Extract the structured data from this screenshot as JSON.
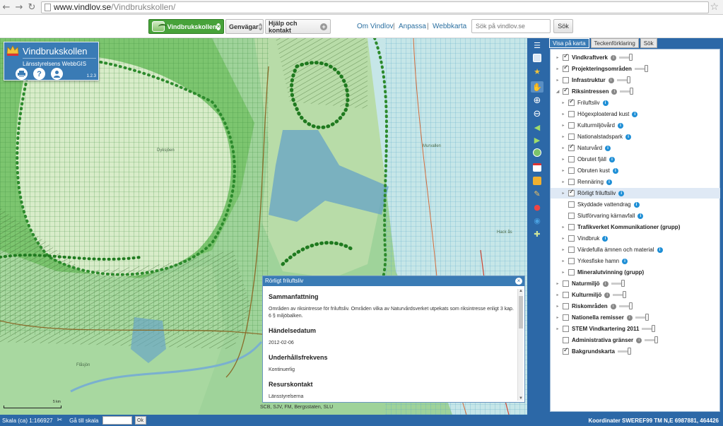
{
  "browser": {
    "url_host": "www.vindlov.se",
    "url_path": "/Vindbrukskollen/"
  },
  "topnav": {
    "tabs": [
      {
        "label": "Vindbrukskollen"
      },
      {
        "label": "Genvägar"
      },
      {
        "label": "Hjälp och kontakt"
      }
    ],
    "links": [
      "Om Vindlov",
      "Anpassa",
      "Webbkarta"
    ],
    "search_placeholder": "Sök på vindlov.se",
    "search_button": "Sök"
  },
  "app": {
    "title": "Vindbrukskollen",
    "subtitle": "Länsstyrelsens WebbGIS",
    "version": "1.2.3"
  },
  "map": {
    "place_labels": [
      "Dyksjöen",
      "Murvallen",
      "Flåsjön",
      "Hack ås"
    ],
    "attribution": "SCB, SJV, FM, Bergsstaten, SLU",
    "scale_label": "5 km"
  },
  "popup": {
    "header": "Rörligt friluftsliv",
    "sections": [
      {
        "heading": "Sammanfattning",
        "text": "Områden av riksintresse för friluftsliv. Områden vilka av Naturvårdsverket utpekats som riksintresse enligt 3 kap. 6 § miljöbalken."
      },
      {
        "heading": "Händelsedatum",
        "text": "2012-02-06"
      },
      {
        "heading": "Underhållsfrekvens",
        "text": "Kontinuerlig"
      },
      {
        "heading": "Resurskontakt",
        "text": "Länsstyrelserna\nKontakt"
      }
    ]
  },
  "panel": {
    "tabs": [
      "Visa på karta",
      "Teckenförklaring",
      "Sök"
    ],
    "layers": [
      {
        "name": "Vindkraftverk",
        "bold": true,
        "level": 0,
        "checked": true,
        "expander": "closed",
        "legend": true,
        "slider": true
      },
      {
        "name": "Projekteringsområden",
        "bold": true,
        "level": 0,
        "checked": true,
        "expander": "closed",
        "legend": false,
        "slider": true
      },
      {
        "name": "Infrastruktur",
        "bold": true,
        "level": 0,
        "checked": false,
        "expander": "closed",
        "legend": true,
        "slider": true
      },
      {
        "name": "Riksintressen",
        "bold": true,
        "level": 0,
        "checked": true,
        "expander": "open",
        "legend": true,
        "slider": true
      },
      {
        "name": "Friluftsliv",
        "bold": false,
        "level": 1,
        "checked": true,
        "expander": "closed",
        "info": true
      },
      {
        "name": "Högexploaterad kust",
        "bold": false,
        "level": 1,
        "checked": false,
        "expander": "closed",
        "info": true
      },
      {
        "name": "Kulturmiljövård",
        "bold": false,
        "level": 1,
        "checked": false,
        "expander": "closed",
        "info": true
      },
      {
        "name": "Nationalstadspark",
        "bold": false,
        "level": 1,
        "checked": false,
        "expander": "closed",
        "info": true
      },
      {
        "name": "Naturvård",
        "bold": false,
        "level": 1,
        "checked": true,
        "expander": "closed",
        "info": true
      },
      {
        "name": "Obrutet fjäll",
        "bold": false,
        "level": 1,
        "checked": false,
        "expander": "closed",
        "info": true
      },
      {
        "name": "Obruten kust",
        "bold": false,
        "level": 1,
        "checked": false,
        "expander": "closed",
        "info": true
      },
      {
        "name": "Rennäring",
        "bold": false,
        "level": 1,
        "checked": false,
        "expander": "closed",
        "info": true
      },
      {
        "name": "Rörligt friluftsliv",
        "bold": false,
        "level": 1,
        "checked": true,
        "expander": "closed",
        "info": true,
        "highlight": true
      },
      {
        "name": "Skyddade vattendrag",
        "bold": false,
        "level": 1,
        "checked": false,
        "expander": "none",
        "info": true
      },
      {
        "name": "Slutförvaring kärnavfall",
        "bold": false,
        "level": 1,
        "checked": false,
        "expander": "none",
        "info": true
      },
      {
        "name": "Trafikverket Kommunikationer (grupp)",
        "bold": true,
        "level": 1,
        "checked": false,
        "expander": "closed"
      },
      {
        "name": "Vindbruk",
        "bold": false,
        "level": 1,
        "checked": false,
        "expander": "closed",
        "info": true
      },
      {
        "name": "Värdefulla ämnen och material",
        "bold": false,
        "level": 1,
        "checked": false,
        "expander": "closed",
        "info": true
      },
      {
        "name": "Yrkesfiske hamn",
        "bold": false,
        "level": 1,
        "checked": false,
        "expander": "closed",
        "info": true
      },
      {
        "name": "Mineralutvinning (grupp)",
        "bold": true,
        "level": 1,
        "checked": false,
        "expander": "closed"
      },
      {
        "name": "Naturmiljö",
        "bold": true,
        "level": 0,
        "checked": false,
        "expander": "closed",
        "legend": true,
        "slider": true
      },
      {
        "name": "Kulturmiljö",
        "bold": true,
        "level": 0,
        "checked": false,
        "expander": "closed",
        "legend": true,
        "slider": true
      },
      {
        "name": "Riskområden",
        "bold": true,
        "level": 0,
        "checked": false,
        "expander": "closed",
        "legend": true,
        "slider": true
      },
      {
        "name": "Nationella remisser",
        "bold": true,
        "level": 0,
        "checked": false,
        "expander": "closed",
        "legend": true,
        "slider": true
      },
      {
        "name": "STEM Vindkartering 2011",
        "bold": true,
        "level": 0,
        "checked": false,
        "expander": "closed",
        "legend": false,
        "slider": true
      },
      {
        "name": "Administrativa gränser",
        "bold": true,
        "level": 0,
        "checked": false,
        "expander": "none",
        "legend": true,
        "slider": true
      },
      {
        "name": "Bakgrundskarta",
        "bold": true,
        "level": 0,
        "checked": true,
        "expander": "none",
        "legend": false,
        "slider": true
      }
    ]
  },
  "statusbar": {
    "scale_text": "Skala (ca) 1:166927",
    "goto_label": "Gå till skala",
    "ok_button": "Ok",
    "coords": "Koordinater SWEREF99 TM N,E 6987881, 464426"
  },
  "colors": {
    "brand_blue": "#2c68a7",
    "active_tab_green": "#47a23a",
    "info_blue": "#1f8fd6"
  }
}
